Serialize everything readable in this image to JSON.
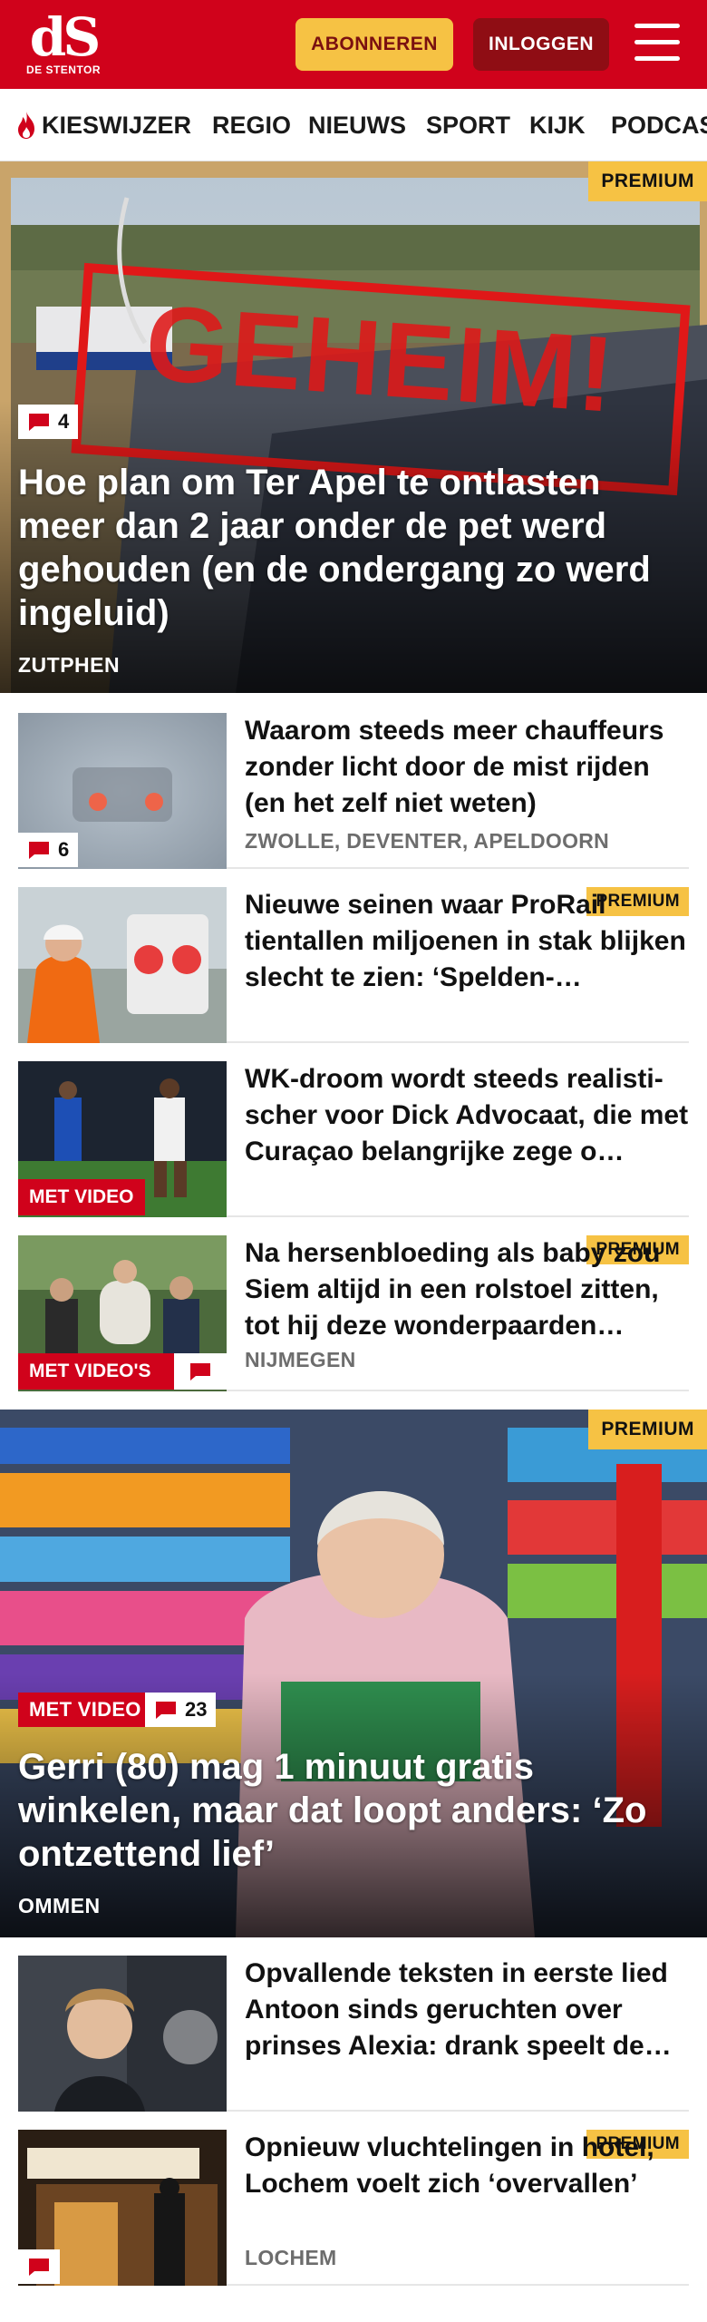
{
  "header": {
    "logo_mark": "dS",
    "logo_name": "DE STENTOR",
    "subscribe_label": "ABONNEREN",
    "login_label": "INLOGGEN",
    "brand_color": "#d0021b",
    "accent_color": "#f6c244"
  },
  "nav": {
    "items": [
      "KIESWIJZER",
      "REGIO",
      "NIEUWS",
      "SPORT",
      "KIJK",
      "PODCAS"
    ]
  },
  "hero1": {
    "badge": "PREMIUM",
    "comments": "4",
    "stamp": "GEHEIM!",
    "title": "Hoe plan om Ter Apel te ontlasten meer dan 2 jaar onder de pet werd gehouden (en de ondergang zo werd ingeluid)",
    "location": "ZUTPHEN"
  },
  "articles": [
    {
      "title": "Waarom steeds meer chauffeurs zonder licht door de mist rijden (en het zelf niet weten)",
      "location": "ZWOLLE, DEVENTER, APELDOORN",
      "comments": "6"
    },
    {
      "badge": "PREMIUM",
      "title": "Nieuwe seinen waar ProRail tientallen miljoenen in stak blijken slecht te zien: ‘Spelden-…"
    },
    {
      "video": "MET VIDEO",
      "title": "WK-droom wordt steeds realisti-scher voor Dick Advocaat, die met Curaçao belangrijke zege o…"
    },
    {
      "badge": "PREMIUM",
      "video": "MET VIDEO'S",
      "title": "Na hersenbloeding als baby zou Siem altijd in een rolstoel zitten, tot hij deze wonderpaarden…",
      "location": "NIJMEGEN"
    }
  ],
  "hero2": {
    "badge": "PREMIUM",
    "video": "MET VIDEO",
    "comments": "23",
    "title": "Gerri (80) mag 1 minuut gratis winkelen, maar dat loopt anders: ‘Zo ontzettend lief’",
    "location": "OMMEN"
  },
  "articles2": [
    {
      "title": "Opvallende teksten in eerste lied Antoon sinds geruchten over prinses Alexia: drank speelt de…"
    },
    {
      "badge": "PREMIUM",
      "title": "Opnieuw vluchtelingen in hotel, Lochem voelt zich ‘overvallen’",
      "location": "LOCHEM"
    }
  ]
}
